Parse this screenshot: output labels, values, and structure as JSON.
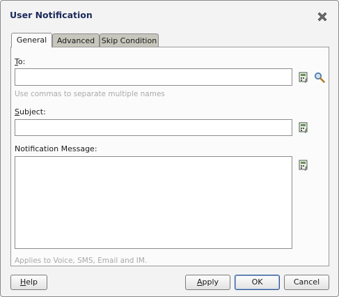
{
  "dialog": {
    "title": "User Notification"
  },
  "tabs": [
    {
      "label": "General",
      "active": true
    },
    {
      "label": "Advanced",
      "active": false
    },
    {
      "label": "Skip Condition",
      "active": false
    }
  ],
  "form": {
    "to": {
      "mnemonic": "T",
      "rest": "o:",
      "value": "",
      "hint": "Use commas to separate multiple names"
    },
    "subject": {
      "mnemonic": "S",
      "rest": "ubject:",
      "value": ""
    },
    "message": {
      "label": "Notification Message:",
      "value": "",
      "hint": "Applies to Voice, SMS, Email and IM."
    }
  },
  "buttons": {
    "help": {
      "mnemonic": "H",
      "rest": "elp"
    },
    "apply": {
      "mnemonic": "A",
      "rest": "pply"
    },
    "ok": "OK",
    "cancel": "Cancel"
  },
  "icons": {
    "expression_builder": "expression-builder-icon",
    "search": "search-icon",
    "close": "close-icon"
  }
}
